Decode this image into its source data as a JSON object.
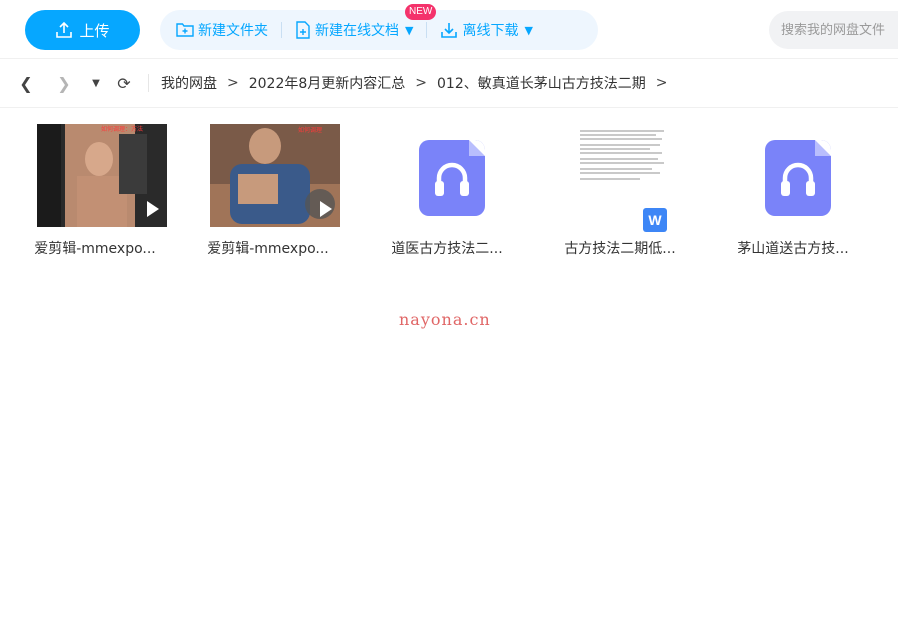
{
  "toolbar": {
    "upload_label": "上传",
    "new_folder_label": "新建文件夹",
    "new_doc_label": "新建在线文档",
    "new_badge": "NEW",
    "offline_label": "离线下载",
    "search_placeholder": "搜索我的网盘文件"
  },
  "breadcrumb": {
    "items": [
      "我的网盘",
      "2022年8月更新内容汇总",
      "012、敏真道长茅山古方技法二期"
    ]
  },
  "files": [
    {
      "name": "爱剪辑-mmexpo...",
      "type": "video",
      "thumb_text": "如何调理：方法"
    },
    {
      "name": "爱剪辑-mmexpo...",
      "type": "video",
      "thumb_text": "如何调理"
    },
    {
      "name": "道医古方技法二...",
      "type": "audio"
    },
    {
      "name": "古方技法二期低...",
      "type": "document",
      "badge": "W"
    },
    {
      "name": "茅山道送古方技...",
      "type": "audio"
    }
  ],
  "watermark": "nayona.cn",
  "colors": {
    "accent": "#06a7ff",
    "audio": "#7a83f9",
    "badge": "#f4326b"
  }
}
